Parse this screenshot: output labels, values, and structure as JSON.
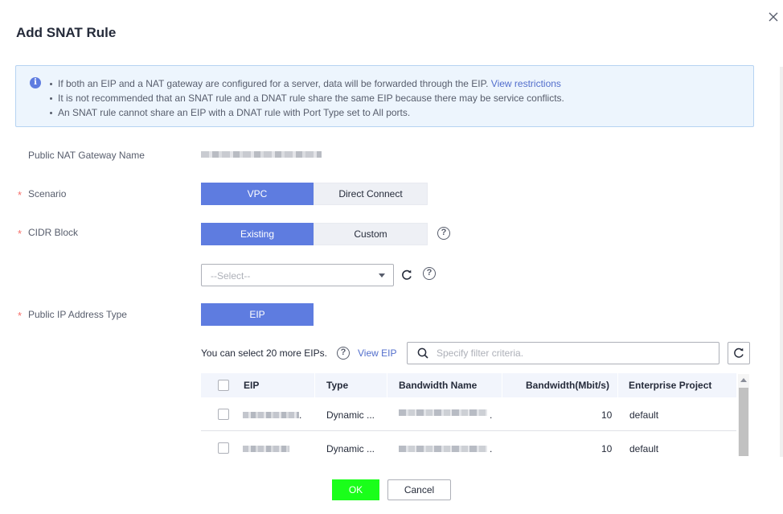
{
  "dialog": {
    "title": "Add SNAT Rule"
  },
  "info": {
    "line1": "If both an EIP and a NAT gateway are configured for a server, data will be forwarded through the EIP.",
    "line1_link": "View restrictions",
    "line2": "It is not recommended that an SNAT rule and a DNAT rule share the same EIP because there may be service conflicts.",
    "line3": "An SNAT rule cannot share an EIP with a DNAT rule with Port Type set to All ports."
  },
  "form": {
    "gateway_label": "Public NAT Gateway Name",
    "scenario_label": "Scenario",
    "scenario_options": [
      "VPC",
      "Direct Connect"
    ],
    "cidr_label": "CIDR Block",
    "cidr_options": [
      "Existing",
      "Custom"
    ],
    "cidr_select_value": "--Select--",
    "ip_type_label": "Public IP Address Type",
    "ip_type_option": "EIP",
    "required_mark": "*"
  },
  "eip": {
    "count_text": "You can select 20 more EIPs.",
    "view_link": "View EIP",
    "search_placeholder": "Specify filter criteria."
  },
  "table": {
    "headers": [
      "EIP",
      "Type",
      "Bandwidth Name",
      "Bandwidth(Mbit/s)",
      "Enterprise Project"
    ],
    "rows": [
      {
        "eip_suffix": ".",
        "type": "Dynamic ...",
        "bandwidth_suffix": ".",
        "bandwidth": "10",
        "project": "default"
      },
      {
        "eip_suffix": "",
        "type": "Dynamic ...",
        "bandwidth_suffix": ".",
        "bandwidth": "10",
        "project": "default"
      }
    ]
  },
  "footer": {
    "ok_label": "OK",
    "cancel_label": "Cancel"
  },
  "colors": {
    "accent": "#5e7ce0",
    "link": "#526ecc",
    "ok_button": "#1aff1a",
    "required": "#f66f6a",
    "info_bg": "#edf5fd"
  },
  "icons": {
    "close": "close-icon",
    "info": "info-icon",
    "help": "help-icon",
    "refresh": "refresh-icon",
    "search": "search-icon",
    "caret": "chevron-down-icon"
  }
}
